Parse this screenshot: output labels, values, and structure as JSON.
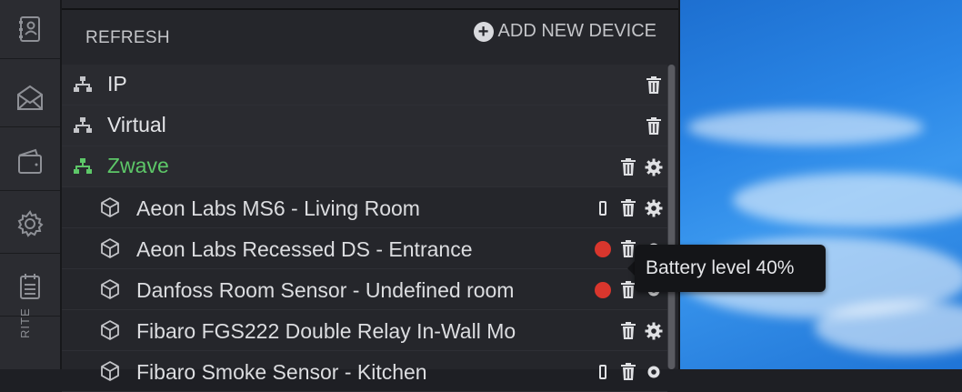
{
  "toolbar": {
    "refresh_label": "REFRESH",
    "add_device_label": "ADD NEW DEVICE"
  },
  "rail": {
    "items": [
      {
        "icon": "address-book-icon"
      },
      {
        "icon": "envelope-icon"
      },
      {
        "icon": "wallet-icon"
      },
      {
        "icon": "gear-icon"
      },
      {
        "icon": "calendar-icon"
      }
    ],
    "vertical_label": "RITE"
  },
  "groups": [
    {
      "label": "IP",
      "active": false
    },
    {
      "label": "Virtual",
      "active": false
    },
    {
      "label": "Zwave",
      "active": true
    }
  ],
  "devices": [
    {
      "label": "Aeon Labs MS6 - Living Room",
      "battery": true,
      "alert": false
    },
    {
      "label": "Aeon Labs Recessed DS - Entrance",
      "battery": false,
      "alert": true
    },
    {
      "label": "Danfoss Room Sensor - Undefined room",
      "battery": false,
      "alert": true
    },
    {
      "label": "Fibaro FGS222 Double Relay In-Wall Mo",
      "battery": false,
      "alert": false
    },
    {
      "label": "Fibaro Smoke Sensor - Kitchen",
      "battery": true,
      "alert": false
    }
  ],
  "tooltip": {
    "text": "Battery level 40%"
  },
  "colors": {
    "active_group": "#5dc768",
    "alert": "#d9362d",
    "panel_bg": "#25262b"
  }
}
